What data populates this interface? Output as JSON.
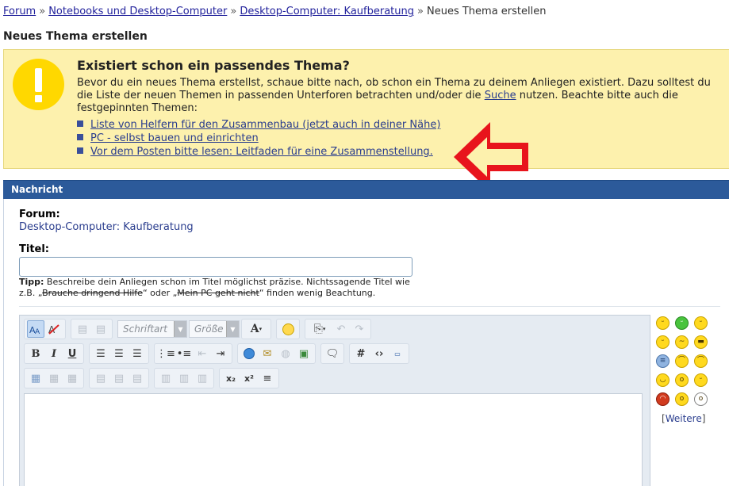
{
  "breadcrumb": {
    "items": [
      "Forum",
      "Notebooks und Desktop-Computer",
      "Desktop-Computer: Kaufberatung"
    ],
    "current": "Neues Thema erstellen",
    "separator": "»"
  },
  "page_title": "Neues Thema erstellen",
  "notice": {
    "heading": "Existiert schon ein passendes Thema?",
    "text_before": "Bevor du ein neues Thema erstellst, schaue bitte nach, ob schon ein Thema zu deinem Anliegen existiert. Dazu solltest du die Liste der neuen Themen in passenden Unterforen betrachten und/oder die ",
    "search_link": "Suche",
    "text_after": " nutzen. Beachte bitte auch die festgepinnten Themen:",
    "links": [
      "Liste von Helfern für den Zusammenbau (jetzt auch in deiner Nähe)",
      "PC - selbst bauen und einrichten",
      "Vor dem Posten bitte lesen: Leitfaden für eine Zusammenstellung."
    ]
  },
  "message": {
    "header": "Nachricht",
    "forum_label": "Forum:",
    "forum_value": "Desktop-Computer: Kaufberatung",
    "title_label": "Titel:",
    "title_value": "",
    "hint_label": "Tipp:",
    "hint_text_1": " Beschreibe dein Anliegen schon im Titel möglichst präzise. Nichtssagende Titel wie z.B. „",
    "hint_example_1": "Brauche dringend Hilfe",
    "hint_text_2": "“ oder „",
    "hint_example_2": "Mein PC geht nicht",
    "hint_text_3": "“ finden wenig Beachtung."
  },
  "editor": {
    "font_combo": "Schriftart",
    "size_combo": "Größe",
    "body_text": ""
  },
  "smilies": {
    "more_open": "[",
    "more_link": "Weitere",
    "more_close": "]"
  },
  "colors": {
    "notice_bg": "#fdf1ad",
    "header_blue": "#2c5a9a",
    "link": "#2a3d8e",
    "arrow_red": "#e8141c"
  }
}
